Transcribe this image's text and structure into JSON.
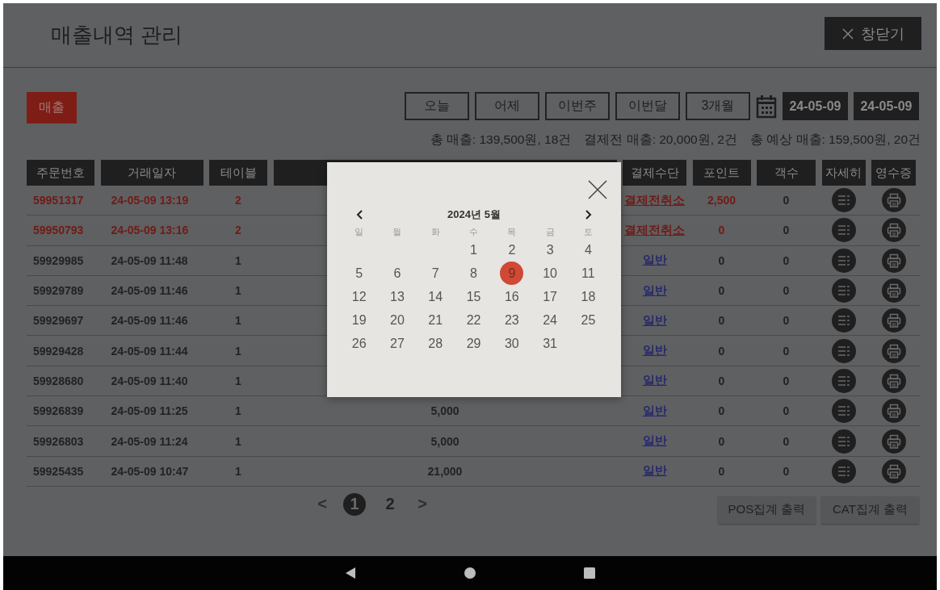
{
  "header": {
    "title": "매출내역 관리",
    "close_button": "창닫기"
  },
  "tabs": [
    {
      "label": "매출",
      "selected": true
    }
  ],
  "period_buttons": [
    {
      "label": "오늘"
    },
    {
      "label": "어제"
    },
    {
      "label": "이번주"
    },
    {
      "label": "이번달"
    },
    {
      "label": "3개월"
    }
  ],
  "date_range": {
    "start": "24-05-09",
    "end": "24-05-09"
  },
  "summary": [
    "총 매출: 139,500원, 18건",
    "결제전 매출: 20,000원, 2건",
    "총 예상 매출: 159,500원, 20건"
  ],
  "table": {
    "columns": [
      "주문번호",
      "거래일자",
      "테이블",
      "결제수단",
      "포인트",
      "객수",
      "자세히",
      "영수증"
    ],
    "rows": [
      {
        "order_no": "59951317",
        "datetime": "24-05-09 13:19",
        "table": "2",
        "payment": "결제전취소",
        "points": "2,500",
        "guests": "0",
        "cancelled": true
      },
      {
        "order_no": "59950793",
        "datetime": "24-05-09 13:16",
        "table": "2",
        "payment": "결제전취소",
        "points": "0",
        "guests": "0",
        "cancelled": true
      },
      {
        "order_no": "59929985",
        "datetime": "24-05-09 11:48",
        "table": "1",
        "payment": "일반",
        "points": "0",
        "guests": "0",
        "cancelled": false
      },
      {
        "order_no": "59929789",
        "datetime": "24-05-09 11:46",
        "table": "1",
        "payment": "일반",
        "points": "0",
        "guests": "0",
        "cancelled": false
      },
      {
        "order_no": "59929697",
        "datetime": "24-05-09 11:46",
        "table": "1",
        "payment": "일반",
        "points": "0",
        "guests": "0",
        "cancelled": false
      },
      {
        "order_no": "59929428",
        "datetime": "24-05-09 11:44",
        "table": "1",
        "payment": "일반",
        "points": "0",
        "guests": "0",
        "cancelled": false
      },
      {
        "order_no": "59928680",
        "datetime": "24-05-09 11:40",
        "table": "1",
        "payment": "일반",
        "points": "0",
        "guests": "0",
        "cancelled": false
      },
      {
        "order_no": "59926839",
        "datetime": "24-05-09 11:25",
        "table": "1",
        "amount": "5,000",
        "payment": "일반",
        "points": "0",
        "guests": "0",
        "cancelled": false
      },
      {
        "order_no": "59926803",
        "datetime": "24-05-09 11:24",
        "table": "1",
        "amount": "5,000",
        "payment": "일반",
        "points": "0",
        "guests": "0",
        "cancelled": false
      },
      {
        "order_no": "59925435",
        "datetime": "24-05-09 10:47",
        "table": "1",
        "amount": "21,000",
        "payment": "일반",
        "points": "0",
        "guests": "0",
        "cancelled": false
      }
    ]
  },
  "pagination": {
    "prev": "<",
    "pages": [
      {
        "label": "1",
        "selected": true
      },
      {
        "label": "2",
        "selected": false
      }
    ],
    "next": ">"
  },
  "footer_buttons": [
    "POS집계 출력",
    "CAT집계 출력"
  ],
  "calendar": {
    "title": "2024년 5월",
    "weekdays": [
      "일",
      "월",
      "화",
      "수",
      "목",
      "금",
      "토"
    ],
    "weeks": [
      [
        {
          "label": "1",
          "selected": false
        },
        {
          "label": "2",
          "selected": false
        },
        {
          "label": "3",
          "selected": false
        },
        {
          "label": "4",
          "selected": false
        }
      ],
      [
        {
          "label": "5",
          "selected": false
        },
        {
          "label": "6",
          "selected": false
        },
        {
          "label": "7",
          "selected": false
        },
        {
          "label": "8",
          "selected": false
        },
        {
          "label": "9",
          "selected": true
        },
        {
          "label": "10",
          "selected": false
        },
        {
          "label": "11",
          "selected": false
        }
      ],
      [
        {
          "label": "12",
          "selected": false
        },
        {
          "label": "13",
          "selected": false
        },
        {
          "label": "14",
          "selected": false
        },
        {
          "label": "15",
          "selected": false
        },
        {
          "label": "16",
          "selected": false
        },
        {
          "label": "17",
          "selected": false
        },
        {
          "label": "18",
          "selected": false
        }
      ],
      [
        {
          "label": "19",
          "selected": false
        },
        {
          "label": "20",
          "selected": false
        },
        {
          "label": "21",
          "selected": false
        },
        {
          "label": "22",
          "selected": false
        },
        {
          "label": "23",
          "selected": false
        },
        {
          "label": "24",
          "selected": false
        },
        {
          "label": "25",
          "selected": false
        }
      ],
      [
        {
          "label": "26",
          "selected": false
        },
        {
          "label": "27",
          "selected": false
        },
        {
          "label": "28",
          "selected": false
        },
        {
          "label": "29",
          "selected": false
        },
        {
          "label": "30",
          "selected": false
        },
        {
          "label": "31",
          "selected": false
        }
      ]
    ]
  }
}
